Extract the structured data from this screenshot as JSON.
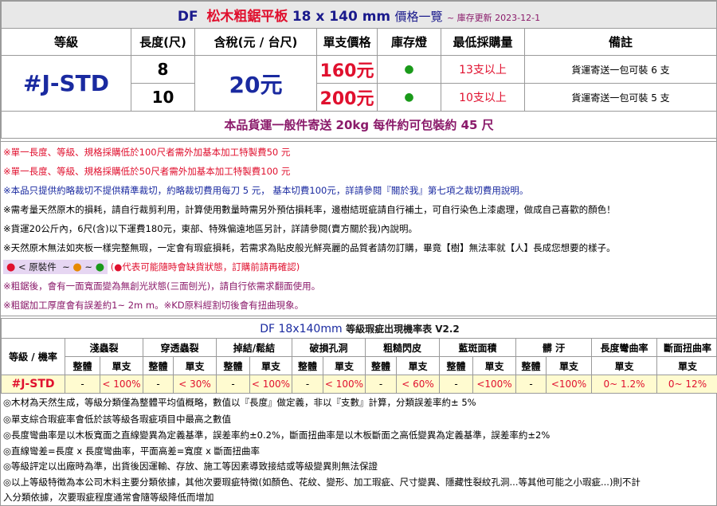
{
  "title": {
    "brand": "DF",
    "name": "松木粗鋸平板",
    "dim": "18 x 140 mm",
    "suffix": "價格一覽",
    "updated": "~ 庫存更新 2023-12-1"
  },
  "headers": {
    "grade": "等級",
    "length": "長度(尺)",
    "price_with_tax": "含稅(元 / 台尺)",
    "unit_price": "單支價格",
    "stock": "庫存燈",
    "min_qty": "最低採購量",
    "remarks": "備註"
  },
  "grade": "#J-STD",
  "price_per_unit": "20元",
  "rows": [
    {
      "length": "8",
      "unit_price": "160元",
      "stock_dot": "●",
      "min_qty": "13支以上",
      "remark": "貨運寄送一包可裝 6 支"
    },
    {
      "length": "10",
      "unit_price": "200元",
      "stock_dot": "●",
      "min_qty": "10支以上",
      "remark": "貨運寄送一包可裝 5 支"
    }
  ],
  "shipping_note": "本品貨運一般件寄送 20kg 每件約可包裝約 45 尺",
  "notes": {
    "n1": "※單一長度、等級、規格採購低於100尺者需外加基本加工特製費50 元",
    "n2": "※單一長度、等級、規格採購低於50尺者需外加基本加工特製費100 元",
    "n3": "※本品只提供約略裁切不提供精準裁切，約略裁切費用每刀 5 元， 基本切費100元，詳請參閱『關於我』第七項之裁切費用說明。",
    "n4": "※需考量天然原木的損耗，請自行裁剪利用，計算使用數量時需另外預估損耗率，邊樹結斑疵請自行補土，可自行染色上漆處理，做成自己喜歡的顏色！",
    "n5": "※貨運20公斤內，6尺(含)以下運費180元，東部、特殊偏遠地區另計，詳請參閱(賣方關於我)內說明。",
    "n6": "※天然原木無法如夾板一樣完整無瑕，一定會有瑕疵損耗，若需求為貼皮般光鮮亮麗的品質者請勿訂購，畢竟【樹】無法率就【人】長成您想要的樣子。",
    "legend_label": "< 原裝件",
    "legend_tilde": "~",
    "legend_note": "(●代表可能隨時會缺貨狀態，訂購前請再確認)",
    "n8": "※粗鋸後，會有一面寬面變為無創光狀態(三面刨光)，請自行依需求翻面使用。",
    "n9": "※粗鋸加工厚度會有誤差約1~ 2m m。※KD原料經割切後會有扭曲現象。"
  },
  "defect": {
    "title": "DF 18x140mm",
    "subtitle": "等級瑕疵出現機率表 V2.2",
    "row_header": "等級 / 機率",
    "groups": [
      "淺蟲裂",
      "穿透蟲裂",
      "掉結/鬆結",
      "破損孔洞",
      "粗糙閃皮",
      "藍斑面積",
      "髒 汙",
      "長度彎曲率",
      "斷面扭曲率"
    ],
    "whole": "整體",
    "single": "單支",
    "grade": "#J-STD",
    "dash": "-",
    "values": [
      "< 100%",
      "< 30%",
      "< 100%",
      "< 100%",
      "< 60%",
      "<100%",
      "<100%",
      "0~ 1.2%",
      "0~ 12%"
    ]
  },
  "footnotes": {
    "f1": "◎木材為天然生成，等級分類僅為整體平均值概略，數值以『長度』做定義，非以『支數』計算，分類誤差率約± 5%",
    "f2": "◎單支綜合瑕疵率會低於該等級各瑕疵項目中最高之數值",
    "f3": "◎長度彎曲率是以木板寬面之直線變異為定義基準，誤差率約±0.2%，斷面扭曲率是以木板斷面之高低變異為定義基準，誤差率約±2%",
    "f4": "◎直線彎差=長度 x 長度彎曲率，平面高差=寬度 x 斷面扭曲率",
    "f5": "◎等級評定以出廠時為準，出貨後因運輸、存放、施工等因素導致接結或等級變異則無法保證",
    "f6a": "◎以上等級特徵為本公司木料主要分類依據，其他次要瑕疵特徵(如顏色、花紋、變形、加工瑕疵、尺寸變異、隱藏性裂紋孔洞...等其他可能之小瑕疵...)則不計",
    "f6b": "入分類依據，次要瑕疵程度通常會隨等級降低而增加"
  },
  "colors": {
    "accent_blue": "#1a2aa0",
    "price_red": "#e0102e",
    "stock_green": "#1a9a1a",
    "highlight_yellow": "#fffbd0"
  }
}
